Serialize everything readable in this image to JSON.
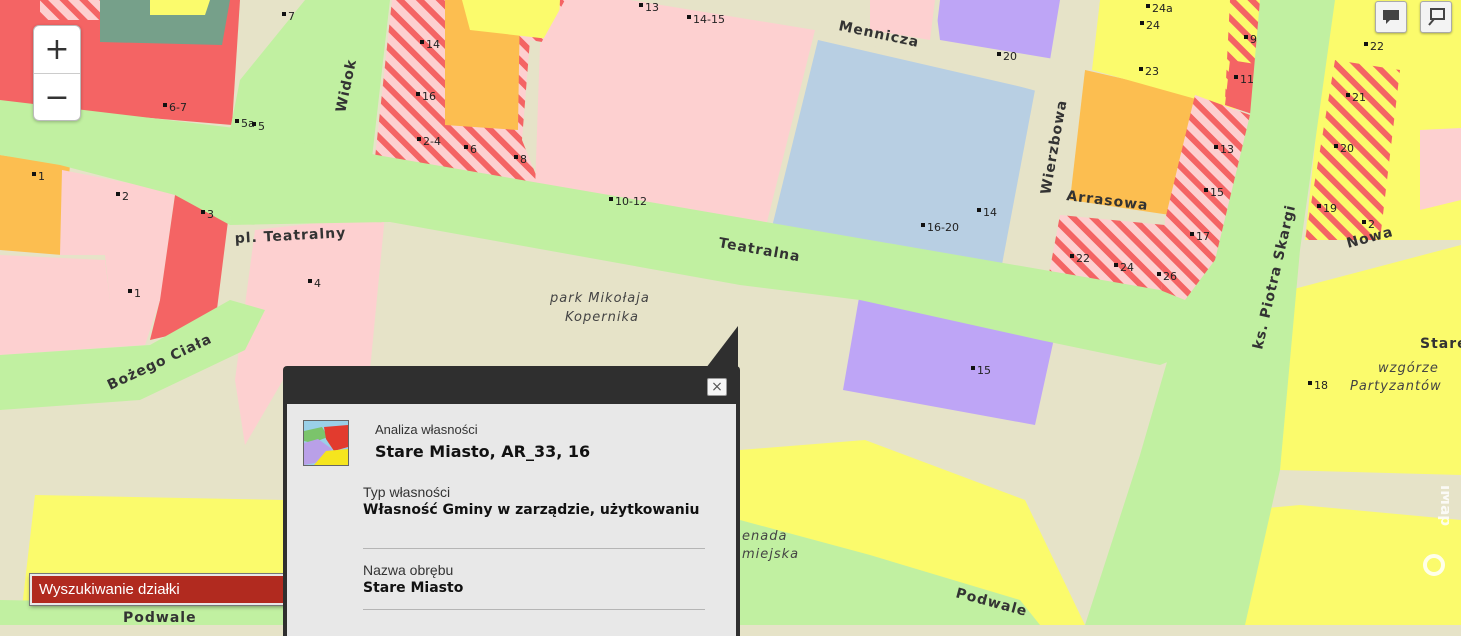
{
  "map": {
    "streets": {
      "mennicza": "Mennicza",
      "widok": "Widok",
      "wierzbowa": "Wierzbowa",
      "arrasowa": "Arrasowa",
      "teatralna": "Teatralna",
      "pl_teatralny": "pl. Teatralny",
      "bozego_ciala": "Bożego Ciała",
      "ks_piotra_skargi": "ks. Piotra Skargi",
      "nowa": "Nowa",
      "podwale_left": "Podwale",
      "podwale_right": "Podwale"
    },
    "place_labels": {
      "park_line1": "park Mikołaja",
      "park_line2": "Kopernika",
      "promenada_line1": "enada",
      "promenada_line2": "miejska",
      "wzgorze_line1": "wzgórze",
      "wzgorze_line2": "Partyzantów",
      "stare_partial": "Stare"
    },
    "numbers": [
      "7",
      "13",
      "14-15",
      "14",
      "16",
      "2-4",
      "6",
      "8",
      "10-12",
      "20",
      "6-7",
      "5a",
      "5",
      "1",
      "2",
      "3",
      "1",
      "4",
      "16-20",
      "14",
      "22",
      "24",
      "26",
      "13",
      "15",
      "17",
      "24a",
      "24",
      "23",
      "9",
      "11",
      "22",
      "21",
      "20",
      "19",
      "2",
      "18",
      "15"
    ],
    "colors": {
      "green_road": "#c1f0a1",
      "beige": "#e6e3c8",
      "pink": "#fdd0d0",
      "red": "#f46464",
      "orange": "#fcbe50",
      "yellow": "#fbfb6c",
      "lilac": "#bea5f6",
      "blue": "#b8cfe3",
      "teal": "#76a08a"
    }
  },
  "controls": {
    "zoom_in": "+",
    "zoom_out": "−",
    "tool1_icon": "comment-icon",
    "tool2_icon": "info-pin-icon"
  },
  "search_panel": {
    "title": "Wyszukiwanie działki"
  },
  "popup": {
    "close": "×",
    "subtitle": "Analiza własności",
    "title": "Stare Miasto, AR_33, 16",
    "fields": [
      {
        "label": "Typ własności",
        "value": "Własność Gminy w zarządzie, użytkowaniu"
      },
      {
        "label": "Nazwa obrębu",
        "value": "Stare Miasto"
      }
    ]
  },
  "brand": {
    "name": "iMap"
  }
}
